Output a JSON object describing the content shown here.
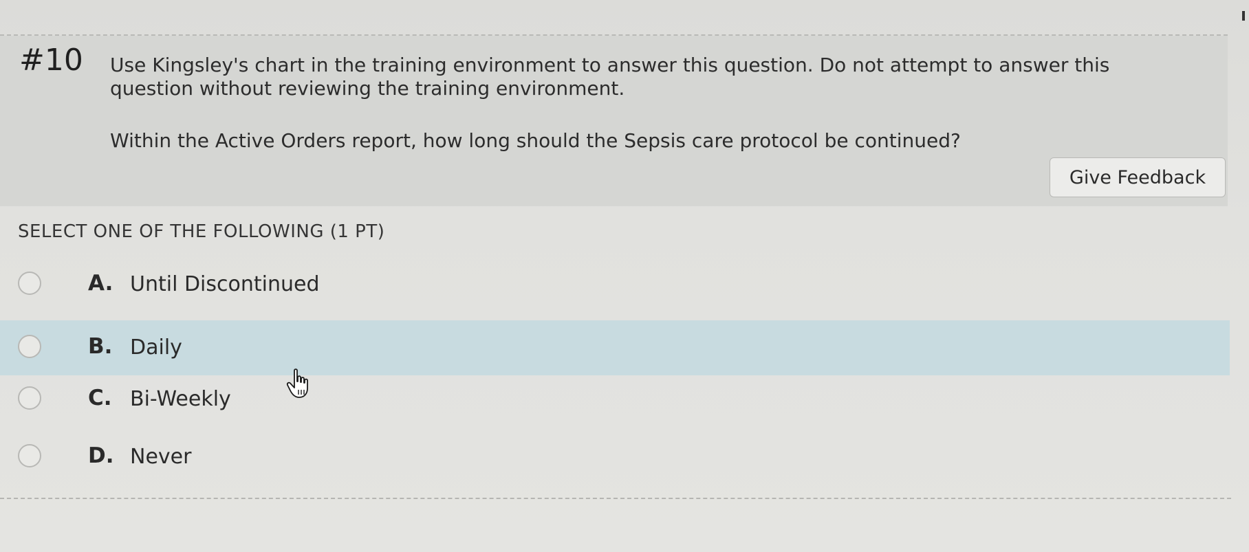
{
  "question": {
    "number": "#10",
    "text": "Use Kingsley's chart in the training environment to answer this question. Do not attempt to answer this question without reviewing the training environment.",
    "subtext": "Within the Active Orders report, how long should the Sepsis care protocol be continued?",
    "feedback_label": "Give Feedback"
  },
  "answers": {
    "instruction": "SELECT ONE OF THE FOLLOWING (1 PT)",
    "options": [
      {
        "letter": "A.",
        "text": "Until Discontinued"
      },
      {
        "letter": "B.",
        "text": "Daily"
      },
      {
        "letter": "C.",
        "text": "Bi-Weekly"
      },
      {
        "letter": "D.",
        "text": "Never"
      }
    ],
    "hovered_option": "B."
  },
  "colors": {
    "panel_bg": "#d5d6d3",
    "hover_bg": "#c8dbe0",
    "page_bg": "#e2e2df"
  },
  "icons": {
    "cursor": "hand-pointer-icon",
    "radio": "radio-empty-icon"
  }
}
